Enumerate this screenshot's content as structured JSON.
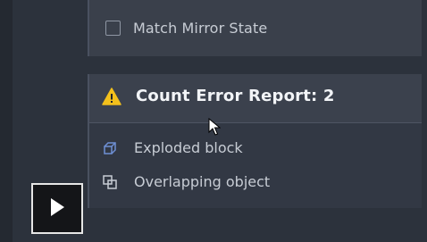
{
  "mirror_option": {
    "label": "Match Mirror State",
    "checked": false
  },
  "report": {
    "title": "Count Error Report: 2",
    "icon": "warning-icon",
    "issues": [
      {
        "label": "Exploded block",
        "icon": "exploded-block-icon"
      },
      {
        "label": "Overlapping object",
        "icon": "overlapping-object-icon"
      }
    ]
  },
  "video": {
    "control": "play-icon"
  },
  "colors": {
    "background": "#2c323c",
    "panel": "#3b414d",
    "warning": "#f3c01c",
    "text": "#c7ccd4",
    "title_text": "#f2f4f7",
    "issue_icon": "#6e8fd4"
  }
}
